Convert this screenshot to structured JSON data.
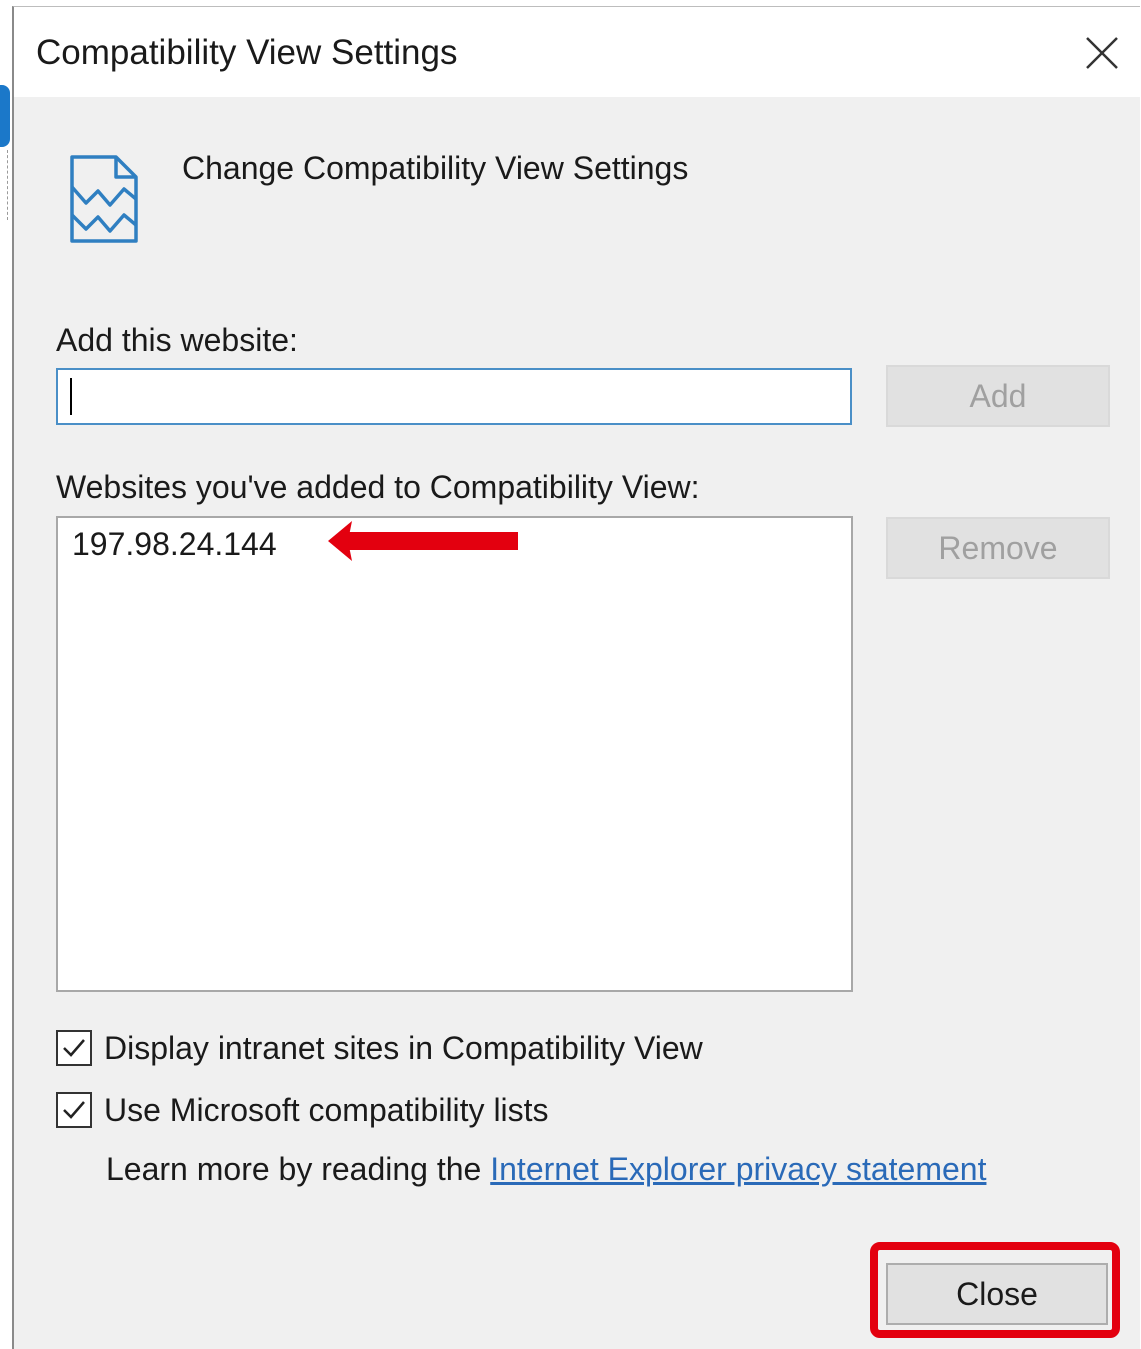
{
  "window": {
    "title": "Compatibility View Settings"
  },
  "header": {
    "text": "Change Compatibility View Settings",
    "icon": "compatibility-page-icon"
  },
  "add_section": {
    "label": "Add this website:",
    "input_value": "",
    "add_button": "Add"
  },
  "list_section": {
    "label": "Websites you've added to Compatibility View:",
    "items": [
      "197.98.24.144"
    ],
    "remove_button": "Remove"
  },
  "options": {
    "intranet": {
      "label": "Display intranet sites in Compatibility View",
      "checked": true
    },
    "ms_lists": {
      "label": "Use Microsoft compatibility lists",
      "checked": true
    }
  },
  "learn_more": {
    "prefix": "Learn more by reading the ",
    "link": "Internet Explorer privacy statement"
  },
  "footer": {
    "close_button": "Close"
  },
  "colors": {
    "annotation_red": "#e3000f",
    "link_blue": "#2a6ab8",
    "input_focus_border": "#4a8fc7",
    "dialog_bg": "#f0f0f0"
  }
}
